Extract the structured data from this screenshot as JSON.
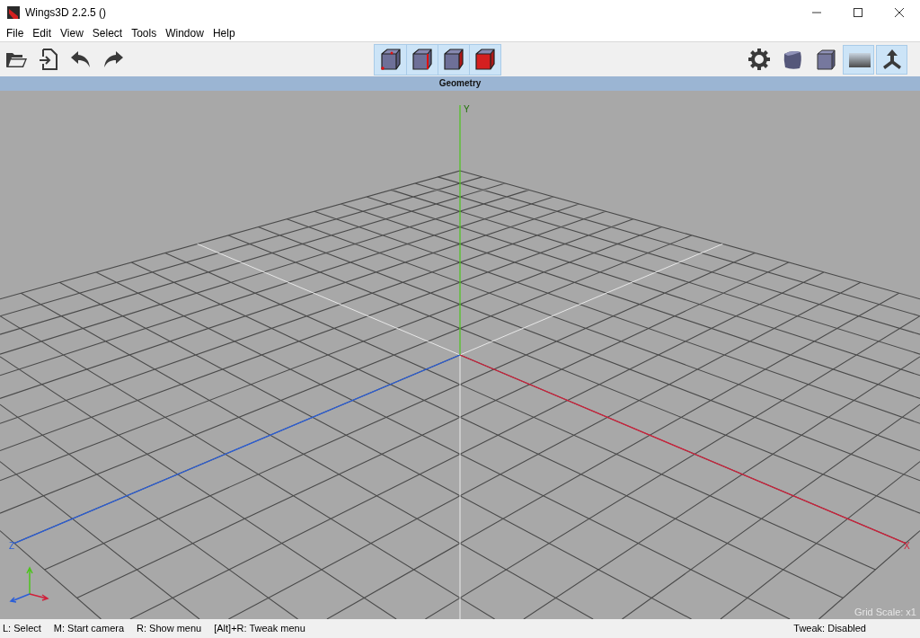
{
  "window": {
    "title": "Wings3D 2.2.5 ()"
  },
  "menu": [
    "File",
    "Edit",
    "View",
    "Select",
    "Tools",
    "Window",
    "Help"
  ],
  "selection_modes": [
    {
      "kind": "vertex"
    },
    {
      "kind": "edge"
    },
    {
      "kind": "face"
    },
    {
      "kind": "body"
    }
  ],
  "view_buttons": [
    {
      "kind": "settings",
      "on": false
    },
    {
      "kind": "smooth",
      "on": false
    },
    {
      "kind": "flat",
      "on": false
    },
    {
      "kind": "ground",
      "on": true
    },
    {
      "kind": "axes",
      "on": true
    }
  ],
  "viewport": {
    "title": "Geometry",
    "axis_labels": [
      {
        "kind": "y",
        "text": "Y"
      },
      {
        "kind": "z",
        "text": "Z"
      },
      {
        "kind": "x",
        "text": "X"
      }
    ],
    "grid_scale": "Grid Scale: x1"
  },
  "status_bar": {
    "hints": [
      "L: Select",
      "M: Start camera",
      "R: Show menu",
      "[Alt]+R: Tweak menu"
    ],
    "tweak": "Tweak: Disabled"
  }
}
